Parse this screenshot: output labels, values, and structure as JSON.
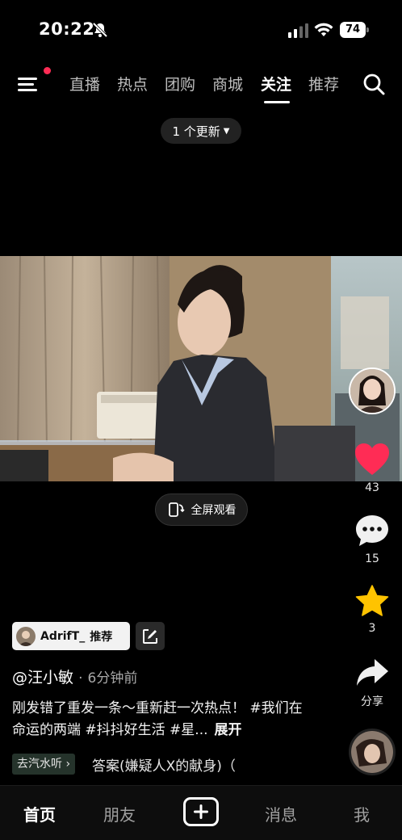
{
  "status_bar": {
    "time": "20:22",
    "battery": "74"
  },
  "top_nav": {
    "tabs": [
      {
        "label": "直播",
        "active": false
      },
      {
        "label": "热点",
        "active": false
      },
      {
        "label": "团购",
        "active": false
      },
      {
        "label": "商城",
        "active": false
      },
      {
        "label": "关注",
        "active": true
      },
      {
        "label": "推荐",
        "active": false
      }
    ]
  },
  "update_pill": {
    "label": "1 个更新"
  },
  "video": {
    "fullscreen_label": "全屏观看"
  },
  "rail": {
    "like_count": "43",
    "comment_count": "15",
    "favorite_count": "3",
    "share_label": "分享"
  },
  "post": {
    "recommender": "AdrifT_",
    "recommend_label": "推荐",
    "author": "@汪小敏",
    "separator": "·",
    "time_ago": "6分钟前",
    "caption": "刚发错了重发一条～重新赶一次热点！ #我们在命运的两端 #抖抖好生活 #星...",
    "expand_label": "展开",
    "listen_label": "去汽水听",
    "music_title": "答案(嫌疑人X的献身)（"
  },
  "bottom_tabs": {
    "home": "首页",
    "friends": "朋友",
    "messages": "消息",
    "me": "我"
  },
  "colors": {
    "like": "#ff2c55",
    "favorite": "#ffc300",
    "badge": "#ff2c55"
  }
}
